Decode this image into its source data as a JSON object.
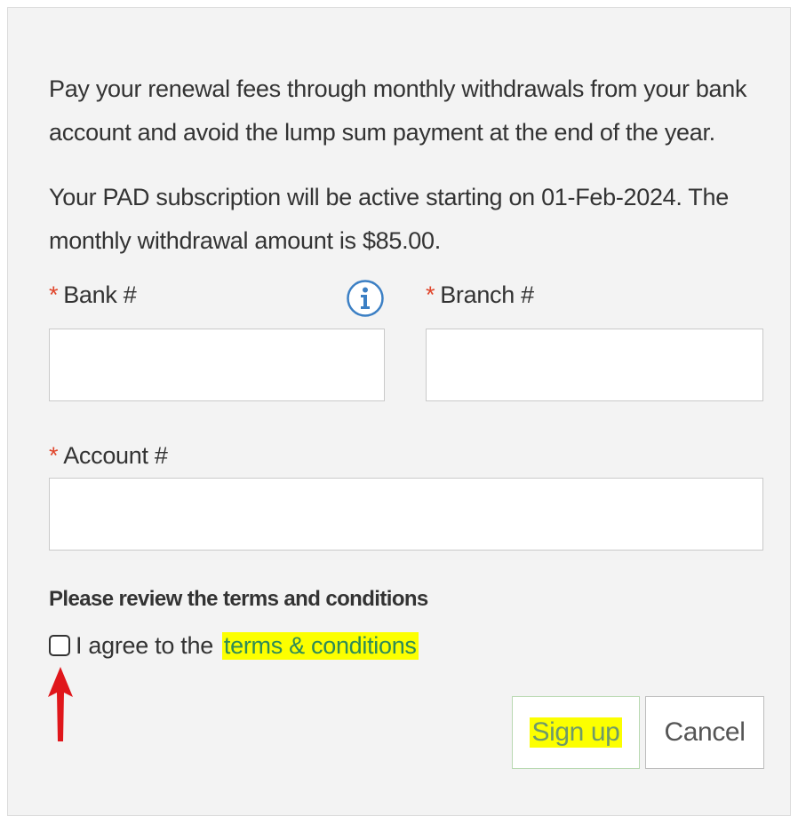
{
  "intro": {
    "line1": "Pay your renewal fees through monthly withdrawals from your bank account and avoid the lump sum payment at the end of the year.",
    "line2": "Your PAD subscription will be active starting on 01-Feb-2024. The monthly withdrawal amount is $85.00."
  },
  "form": {
    "required_marker": "*",
    "bank_label": "Bank #",
    "branch_label": "Branch #",
    "account_label": "Account #",
    "bank_value": "",
    "branch_value": "",
    "account_value": "",
    "info_icon": "info-icon"
  },
  "terms": {
    "review_text": "Please review the terms and conditions",
    "agree_text": "I agree to the",
    "link_text": "terms & conditions",
    "checked": false
  },
  "buttons": {
    "signup_label": "Sign up",
    "cancel_label": "Cancel"
  },
  "colors": {
    "required": "#e0452b",
    "highlight": "#fcff00",
    "link": "#2e8b57",
    "annotation_arrow": "#e0161b",
    "panel_background": "#f3f3f3"
  },
  "annotation": {
    "arrow_icon": "red-up-arrow"
  }
}
